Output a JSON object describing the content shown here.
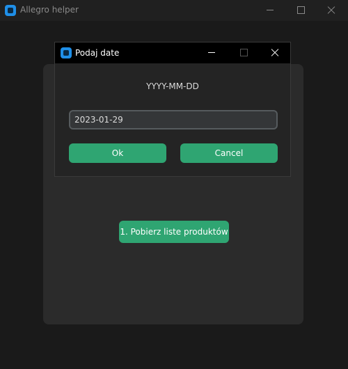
{
  "main_window": {
    "title": "Allegro helper",
    "icon": "app-icon",
    "action_button_label": "1. Pobierz liste produktów"
  },
  "dialog": {
    "title": "Podaj date",
    "icon": "app-icon",
    "prompt": "YYYY-MM-DD",
    "input_value": "2023-01-29",
    "ok_label": "Ok",
    "cancel_label": "Cancel"
  },
  "colors": {
    "accent": "#2fa572",
    "app_icon": "#1f8fe8",
    "window_background": "#1a1a1a",
    "frame_background": "#2b2b2b"
  }
}
